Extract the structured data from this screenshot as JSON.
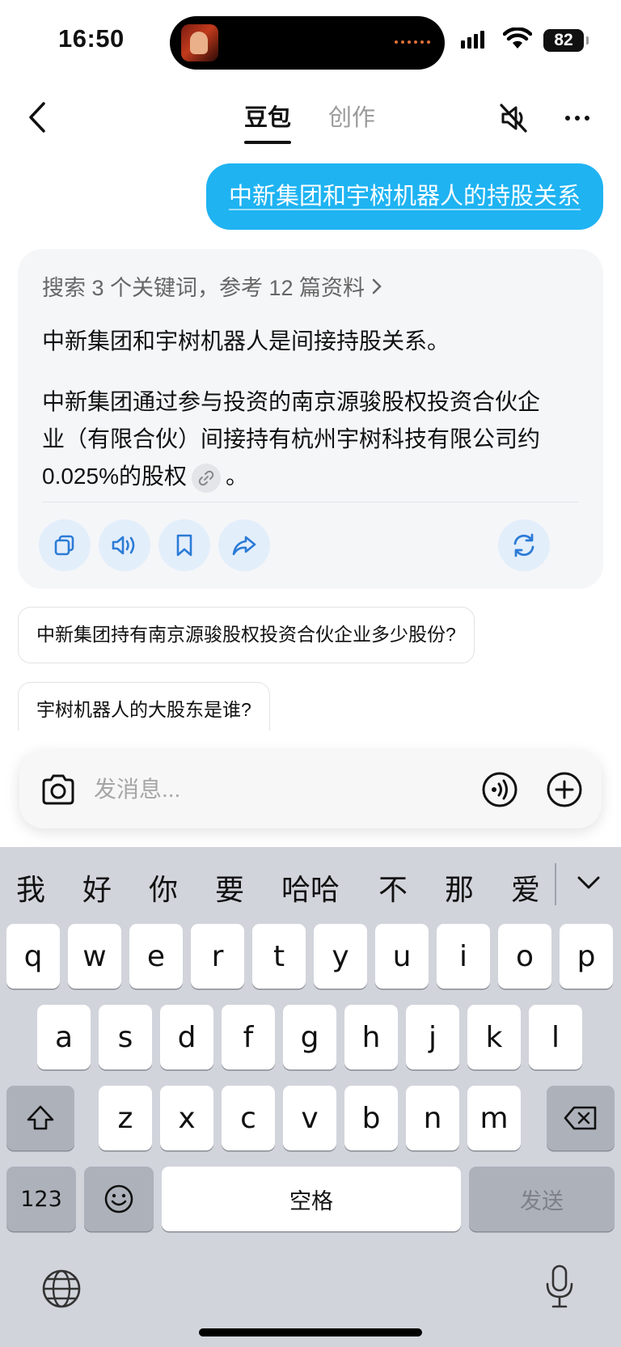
{
  "status_bar": {
    "time": "16:50",
    "battery": "82"
  },
  "nav": {
    "back_icon": "chevron-left-icon",
    "tab_active": "豆包",
    "tab_inactive": "创作",
    "mute_icon": "speaker-muted-icon",
    "more_icon": "more-dots-icon"
  },
  "chat": {
    "user_message": "中新集团和宇树机器人的持股关系",
    "search_summary": "搜索 3 个关键词，参考 12 篇资料",
    "answer_p1": "中新集团和宇树机器人是间接持股关系。",
    "answer_p2_line1": "中新集团通过参与投资的南京源骏股权投资合伙企",
    "answer_p2_line2": "业（有限合伙）间接持有杭州宇树科技有限公司约",
    "answer_p2_line3": "0.025%的股权",
    "answer_p2_end": "。",
    "actions": [
      "copy-icon",
      "speaker-icon",
      "bookmark-icon",
      "share-icon",
      "regenerate-icon"
    ]
  },
  "suggestions": [
    "中新集团持有南京源骏股权投资合伙企业多少股份?",
    "宇树机器人的大股东是谁?"
  ],
  "input": {
    "placeholder": "发消息..."
  },
  "keyboard": {
    "candidates": [
      "我",
      "好",
      "你",
      "要",
      "哈哈",
      "不",
      "那",
      "爱"
    ],
    "row1": [
      "q",
      "w",
      "e",
      "r",
      "t",
      "y",
      "u",
      "i",
      "o",
      "p"
    ],
    "row2": [
      "a",
      "s",
      "d",
      "f",
      "g",
      "h",
      "j",
      "k",
      "l"
    ],
    "row3": [
      "z",
      "x",
      "c",
      "v",
      "b",
      "n",
      "m"
    ],
    "numbers": "123",
    "space": "空格",
    "send": "发送"
  },
  "colors": {
    "accent": "#1fb3f2",
    "action_bg": "#e3eefb",
    "action_icon": "#2b7bd6",
    "keyboard_bg": "#d1d4db"
  }
}
